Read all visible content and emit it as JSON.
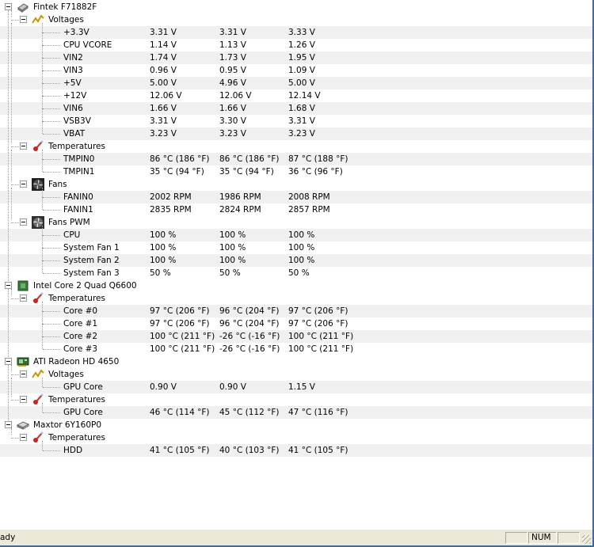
{
  "nodes": [
    {
      "level": 0,
      "kind": "device",
      "icon": "chip-icon",
      "label": "Fintek F71882F"
    },
    {
      "level": 1,
      "kind": "group",
      "icon": "voltage-icon",
      "label": "Voltages"
    },
    {
      "level": 2,
      "kind": "sensor",
      "label": "+3.3V",
      "v1": "3.31 V",
      "v2": "3.31 V",
      "v3": "3.33 V"
    },
    {
      "level": 2,
      "kind": "sensor",
      "label": "CPU VCORE",
      "v1": "1.14 V",
      "v2": "1.13 V",
      "v3": "1.26 V"
    },
    {
      "level": 2,
      "kind": "sensor",
      "label": "VIN2",
      "v1": "1.74 V",
      "v2": "1.73 V",
      "v3": "1.95 V"
    },
    {
      "level": 2,
      "kind": "sensor",
      "label": "VIN3",
      "v1": "0.96 V",
      "v2": "0.95 V",
      "v3": "1.09 V"
    },
    {
      "level": 2,
      "kind": "sensor",
      "label": "+5V",
      "v1": "5.00 V",
      "v2": "4.96 V",
      "v3": "5.00 V"
    },
    {
      "level": 2,
      "kind": "sensor",
      "label": "+12V",
      "v1": "12.06 V",
      "v2": "12.06 V",
      "v3": "12.14 V"
    },
    {
      "level": 2,
      "kind": "sensor",
      "label": "VIN6",
      "v1": "1.66 V",
      "v2": "1.66 V",
      "v3": "1.68 V"
    },
    {
      "level": 2,
      "kind": "sensor",
      "label": "VSB3V",
      "v1": "3.31 V",
      "v2": "3.30 V",
      "v3": "3.31 V"
    },
    {
      "level": 2,
      "kind": "sensor",
      "label": "VBAT",
      "v1": "3.23 V",
      "v2": "3.23 V",
      "v3": "3.23 V"
    },
    {
      "level": 1,
      "kind": "group",
      "icon": "thermometer-icon",
      "label": "Temperatures"
    },
    {
      "level": 2,
      "kind": "sensor",
      "label": "TMPIN0",
      "v1": "86 °C  (186 °F)",
      "v2": "86 °C  (186 °F)",
      "v3": "87 °C  (188 °F)"
    },
    {
      "level": 2,
      "kind": "sensor",
      "label": "TMPIN1",
      "v1": "35 °C  (94 °F)",
      "v2": "35 °C  (94 °F)",
      "v3": "36 °C  (96 °F)"
    },
    {
      "level": 1,
      "kind": "group",
      "icon": "fan-icon",
      "label": "Fans"
    },
    {
      "level": 2,
      "kind": "sensor",
      "label": "FANIN0",
      "v1": "2002 RPM",
      "v2": "1986 RPM",
      "v3": "2008 RPM"
    },
    {
      "level": 2,
      "kind": "sensor",
      "label": "FANIN1",
      "v1": "2835 RPM",
      "v2": "2824 RPM",
      "v3": "2857 RPM"
    },
    {
      "level": 1,
      "kind": "group",
      "icon": "fan-pwm-icon",
      "label": "Fans PWM"
    },
    {
      "level": 2,
      "kind": "sensor",
      "label": "CPU",
      "v1": "100 %",
      "v2": "100 %",
      "v3": "100 %"
    },
    {
      "level": 2,
      "kind": "sensor",
      "label": "System Fan 1",
      "v1": "100 %",
      "v2": "100 %",
      "v3": "100 %"
    },
    {
      "level": 2,
      "kind": "sensor",
      "label": "System Fan 2",
      "v1": "100 %",
      "v2": "100 %",
      "v3": "100 %"
    },
    {
      "level": 2,
      "kind": "sensor",
      "label": "System Fan 3",
      "v1": "50 %",
      "v2": "50 %",
      "v3": "50 %"
    },
    {
      "level": 0,
      "kind": "device",
      "icon": "cpu-icon",
      "label": "Intel Core 2 Quad Q6600"
    },
    {
      "level": 1,
      "kind": "group",
      "icon": "thermometer-icon",
      "label": "Temperatures"
    },
    {
      "level": 2,
      "kind": "sensor",
      "label": "Core #0",
      "v1": "97 °C  (206 °F)",
      "v2": "96 °C  (204 °F)",
      "v3": "97 °C  (206 °F)"
    },
    {
      "level": 2,
      "kind": "sensor",
      "label": "Core #1",
      "v1": "97 °C  (206 °F)",
      "v2": "96 °C  (204 °F)",
      "v3": "97 °C  (206 °F)"
    },
    {
      "level": 2,
      "kind": "sensor",
      "label": "Core #2",
      "v1": "100 °C  (211 °F)",
      "v2": "-26 °C  (-16 °F)",
      "v3": "100 °C  (211 °F)"
    },
    {
      "level": 2,
      "kind": "sensor",
      "label": "Core #3",
      "v1": "100 °C  (211 °F)",
      "v2": "-26 °C  (-16 °F)",
      "v3": "100 °C  (211 °F)"
    },
    {
      "level": 0,
      "kind": "device",
      "icon": "gpu-icon",
      "label": "ATI Radeon HD 4650"
    },
    {
      "level": 1,
      "kind": "group",
      "icon": "voltage-icon",
      "label": "Voltages"
    },
    {
      "level": 2,
      "kind": "sensor",
      "label": "GPU Core",
      "v1": "0.90 V",
      "v2": "0.90 V",
      "v3": "1.15 V"
    },
    {
      "level": 1,
      "kind": "group",
      "icon": "thermometer-icon",
      "label": "Temperatures"
    },
    {
      "level": 2,
      "kind": "sensor",
      "label": "GPU Core",
      "v1": "46 °C  (114 °F)",
      "v2": "45 °C  (112 °F)",
      "v3": "47 °C  (116 °F)"
    },
    {
      "level": 0,
      "kind": "device",
      "icon": "hdd-icon",
      "label": "Maxtor 6Y160P0"
    },
    {
      "level": 1,
      "kind": "group",
      "icon": "thermometer-icon",
      "label": "Temperatures"
    },
    {
      "level": 2,
      "kind": "sensor",
      "label": "HDD",
      "v1": "41 °C  (105 °F)",
      "v2": "40 °C  (103 °F)",
      "v3": "41 °C  (105 °F)"
    }
  ],
  "status": {
    "text": "ady",
    "num_indicator": "NUM"
  },
  "colors": {
    "row_shade": "#f0f0f0",
    "statusbar_bg": "#ece9d8",
    "frame_border": "#3a6ea5"
  }
}
